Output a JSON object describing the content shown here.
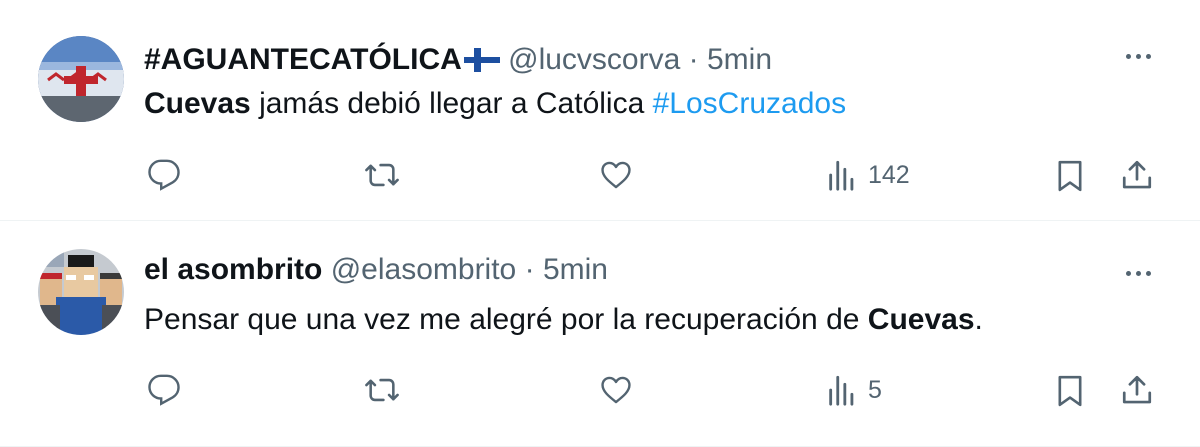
{
  "tweets": [
    {
      "display_name": "#AGUANTECATÓLICA",
      "handle": "@lucvscorva",
      "separator": "·",
      "time": "5min",
      "text_bold": "Cuevas",
      "text_rest": " jamás debió llegar a Católica ",
      "hashtag": "#LosCruzados",
      "views": "142"
    },
    {
      "display_name": "el asombrito",
      "handle": "@elasombrito",
      "separator": "·",
      "time": "5min",
      "text_pre": "Pensar que una vez me alegré por la recuperación de ",
      "text_bold": "Cuevas",
      "text_post": ".",
      "views": "5"
    }
  ],
  "icons": {
    "reply": "reply-icon",
    "retweet": "retweet-icon",
    "like": "heart-icon",
    "views": "views-icon",
    "bookmark": "bookmark-icon",
    "share": "share-icon",
    "more": "more-icon",
    "flag": "finland-flag-icon"
  },
  "colors": {
    "text": "#0f1419",
    "secondary": "#536471",
    "hashtag": "#1d9bf0",
    "divider": "#eff3f4"
  }
}
